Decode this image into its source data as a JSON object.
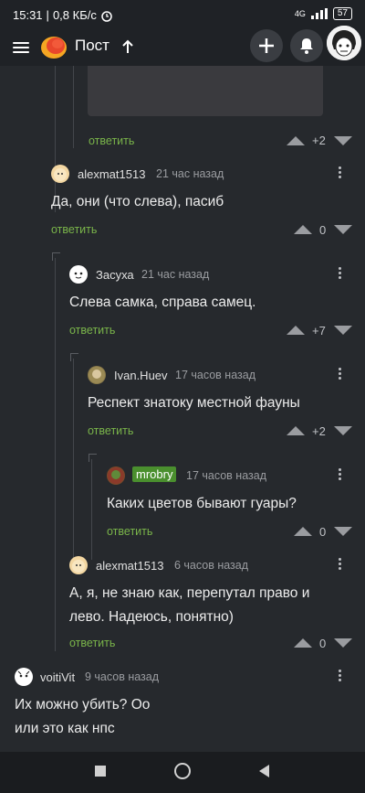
{
  "status": {
    "time": "15:31",
    "speed": "0,8 КБ/с",
    "network": "4G",
    "battery": "57"
  },
  "header": {
    "title": "Пост",
    "add_icon": "plus-icon",
    "notify_icon": "bell-icon"
  },
  "post": {
    "reply_label": "ответить",
    "score": "+2"
  },
  "comments": [
    {
      "author": "alexmat1513",
      "time": "21 час назад",
      "text": "Да, они (что слева), пасиб",
      "reply": "ответить",
      "score": "0"
    },
    {
      "author": "Засуха",
      "time": "21 час назад",
      "text": "Слева самка, справа самец.",
      "reply": "ответить",
      "score": "+7"
    },
    {
      "author": "Ivan.Huev",
      "time": "17 часов назад",
      "text": "Респект знатоку местной фауны",
      "reply": "ответить",
      "score": "+2"
    },
    {
      "author": "mrobry",
      "time": "17 часов назад",
      "text": "Каких цветов бывают гуары?",
      "reply": "ответить",
      "score": "0"
    },
    {
      "author": "alexmat1513",
      "time": "6 часов назад",
      "text_line1": "А, я, не знаю как, перепутал право и",
      "text_line2": "лево. Надеюсь, понятно)",
      "reply": "ответить",
      "score": "0"
    },
    {
      "author": "voitiVit",
      "time": "9 часов назад",
      "text_line1": "Их можно убить? Оо",
      "text_line2": "или это как нпс"
    }
  ],
  "colors": {
    "accent_green": "#7ab54a",
    "background": "#26292d",
    "badge_green": "#4a8f2e"
  }
}
